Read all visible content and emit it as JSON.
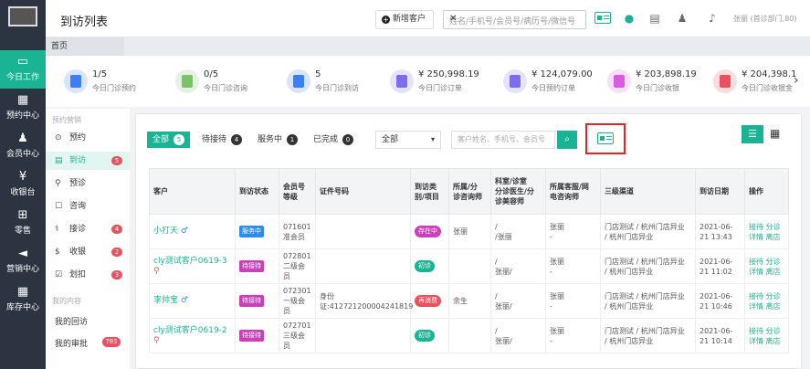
{
  "nav": {
    "items": [
      {
        "label": "今日工作",
        "icon": "monitor-icon",
        "active": true
      },
      {
        "label": "预约中心",
        "icon": "calendar-icon",
        "active": false
      },
      {
        "label": "会员中心",
        "icon": "users-icon",
        "active": false
      },
      {
        "label": "收银台",
        "icon": "yen-icon",
        "active": false
      },
      {
        "label": "零售",
        "icon": "cart-icon",
        "active": false
      },
      {
        "label": "营销中心",
        "icon": "megaphone-icon",
        "active": false
      },
      {
        "label": "库存中心",
        "icon": "grid-icon",
        "active": false
      }
    ]
  },
  "header": {
    "title": "到访列表",
    "new_customer": "新增客户",
    "search_placeholder": "姓名/手机号/会员号/病历号/微信号",
    "user": "张丽 (首诊部门,80)"
  },
  "tabs": {
    "first": "首页"
  },
  "stats": [
    {
      "value": "1/5",
      "label": "今日门诊预约",
      "color": "#3b7ff2"
    },
    {
      "value": "0/5",
      "label": "今日门诊咨询",
      "color": "#7ac16a"
    },
    {
      "value": "5",
      "label": "今日门诊到访",
      "color": "#3b7ff2"
    },
    {
      "value": "¥ 250,998.19",
      "label": "今日门诊订单",
      "color": "#7c6cf0"
    },
    {
      "value": "¥ 124,079.00",
      "label": "今日预约订单",
      "color": "#7c6cf0"
    },
    {
      "value": "¥ 203,898.19",
      "label": "今日门诊收银",
      "color": "#d95be0"
    },
    {
      "value": "¥ 204,398.1",
      "label": "今日门诊收银金",
      "color": "#e8515d"
    }
  ],
  "side": {
    "group1": "预约营销",
    "items": [
      {
        "label": "预约",
        "badge": ""
      },
      {
        "label": "到访",
        "badge": "5",
        "active": true
      },
      {
        "label": "预诊",
        "badge": ""
      },
      {
        "label": "咨询",
        "badge": ""
      },
      {
        "label": "接诊",
        "badge": "4"
      },
      {
        "label": "收银",
        "badge": "2"
      },
      {
        "label": "划扣",
        "badge": "3"
      }
    ],
    "group2": "我的内容",
    "plain": [
      {
        "label": "我的回访",
        "badge": ""
      },
      {
        "label": "我的审批",
        "badge": "785"
      }
    ]
  },
  "filters": [
    {
      "label": "全部",
      "count": "5",
      "active": true
    },
    {
      "label": "待接待",
      "count": "4"
    },
    {
      "label": "服务中",
      "count": "1"
    },
    {
      "label": "已完成",
      "count": "0"
    }
  ],
  "select": {
    "value": "全部"
  },
  "search2": {
    "placeholder": "客户姓名、手机号、会员号"
  },
  "table": {
    "headers": [
      "客户",
      "到访状态",
      "会员号\n等级",
      "证件号码",
      "到访类\n别/项目",
      "所属/分\n诊咨询师",
      "科室/诊室\n分诊医生/分\n诊美容师",
      "所属客服/网\n电咨询师",
      "三级渠道",
      "到访日期",
      "操作"
    ],
    "rows": [
      {
        "name": "小打天",
        "status": "服务中",
        "status_color": "blue",
        "member": "071601\n准会员",
        "id": "",
        "visit": "存在中",
        "visit_color": "purple",
        "consult": "张丽",
        "dept": "/\n/张丽",
        "cs": "张丽\n-",
        "channel": "门店测试 / 杭州门店异业\n/ 杭州门店异业",
        "date": "2021-06-\n21 13:43",
        "ops": "接待 分诊\n详情 离店"
      },
      {
        "name": "cly测试客户0619-3",
        "status": "待接待",
        "status_color": "purple",
        "member": "072801\n二级会\n员",
        "id": "",
        "visit": "初诊",
        "visit_color": "green",
        "consult": "",
        "dept": "/\n张丽/",
        "cs": "张丽\n-",
        "channel": "门店测试 / 杭州门店异业\n/ 杭州门店异业",
        "date": "2021-06-\n21 11:02",
        "ops": "接待 分诊\n详情 离店"
      },
      {
        "name": "李帅宝",
        "status": "待接待",
        "status_color": "purple",
        "member": "072301\n一级会\n员",
        "id": "身份\n证:412721200004241819",
        "visit": "再消费",
        "visit_color": "red",
        "consult": "余生",
        "dept": "/\n张丽/",
        "cs": "张丽\n-",
        "channel": "门店测试 / 杭州门店异业\n/ 杭州门店异业",
        "date": "2021-06-\n21 10:46",
        "ops": "接待 分诊\n详情 离店"
      },
      {
        "name": "cly测试客户0619-2",
        "status": "待接待",
        "status_color": "purple",
        "member": "072701\n三级会\n员",
        "id": "",
        "visit": "初诊",
        "visit_color": "green",
        "consult": "",
        "dept": "/\n张丽/",
        "cs": "张丽\n-",
        "channel": "门店测试 / 杭州门店异业\n/ 杭州门店异业",
        "date": "2021-06-\n21 10:14",
        "ops": "接待 分诊\n详情 离店"
      }
    ]
  }
}
